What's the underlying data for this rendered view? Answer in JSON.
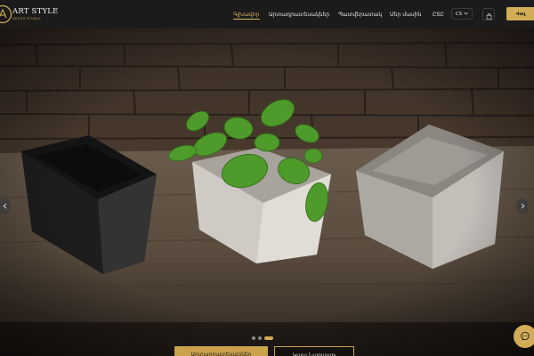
{
  "brand": {
    "title": "ART STYLE",
    "subtitle": "DECOR STUDIO"
  },
  "nav": {
    "items": [
      {
        "label": "Գլխավոր",
        "active": true
      },
      {
        "label": "Արտադրատեսակներ",
        "active": false
      },
      {
        "label": "Պատվերատակ",
        "active": false
      },
      {
        "label": "Մեր մասին",
        "active": false
      },
      {
        "label": "ԸՏԸ",
        "active": false
      }
    ]
  },
  "language": {
    "current": "CS"
  },
  "header": {
    "login_label": "Վալ"
  },
  "hero": {
    "prev_icon": "chevron-left-icon",
    "next_icon": "chevron-right-icon",
    "slides_total": 3,
    "active_slide": 3,
    "primary_cta": "Արտադրատեսակներ",
    "secondary_cta": "Կապ Նարաաթ"
  },
  "colors": {
    "accent": "#d2ad55",
    "header_bg": "#1b1b1b"
  }
}
